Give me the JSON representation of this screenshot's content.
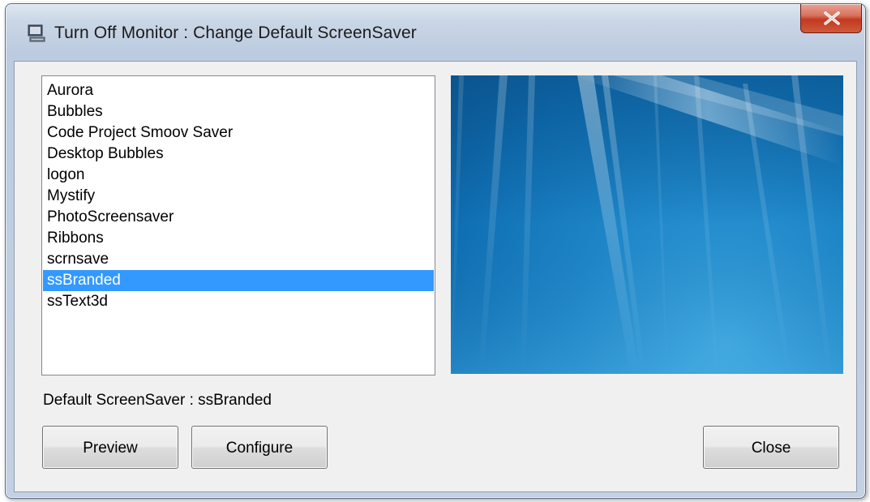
{
  "window": {
    "title": "Turn Off Monitor : Change Default ScreenSaver"
  },
  "screensavers": {
    "items": [
      "Aurora",
      "Bubbles",
      "Code Project Smoov Saver",
      "Desktop Bubbles",
      "logon",
      "Mystify",
      "PhotoScreensaver",
      "Ribbons",
      "scrnsave",
      "ssBranded",
      "ssText3d"
    ],
    "selected": "ssBranded"
  },
  "status": {
    "default_label": "Default ScreenSaver : ssBranded"
  },
  "buttons": {
    "preview_label": "Preview",
    "configure_label": "Configure",
    "close_label": "Close"
  },
  "icons": {
    "app": "monitor-icon",
    "close": "close-icon"
  },
  "colors": {
    "selection": "#3399ff",
    "preview_bg": "#1f87c9",
    "close_button": "#c23a1f"
  }
}
